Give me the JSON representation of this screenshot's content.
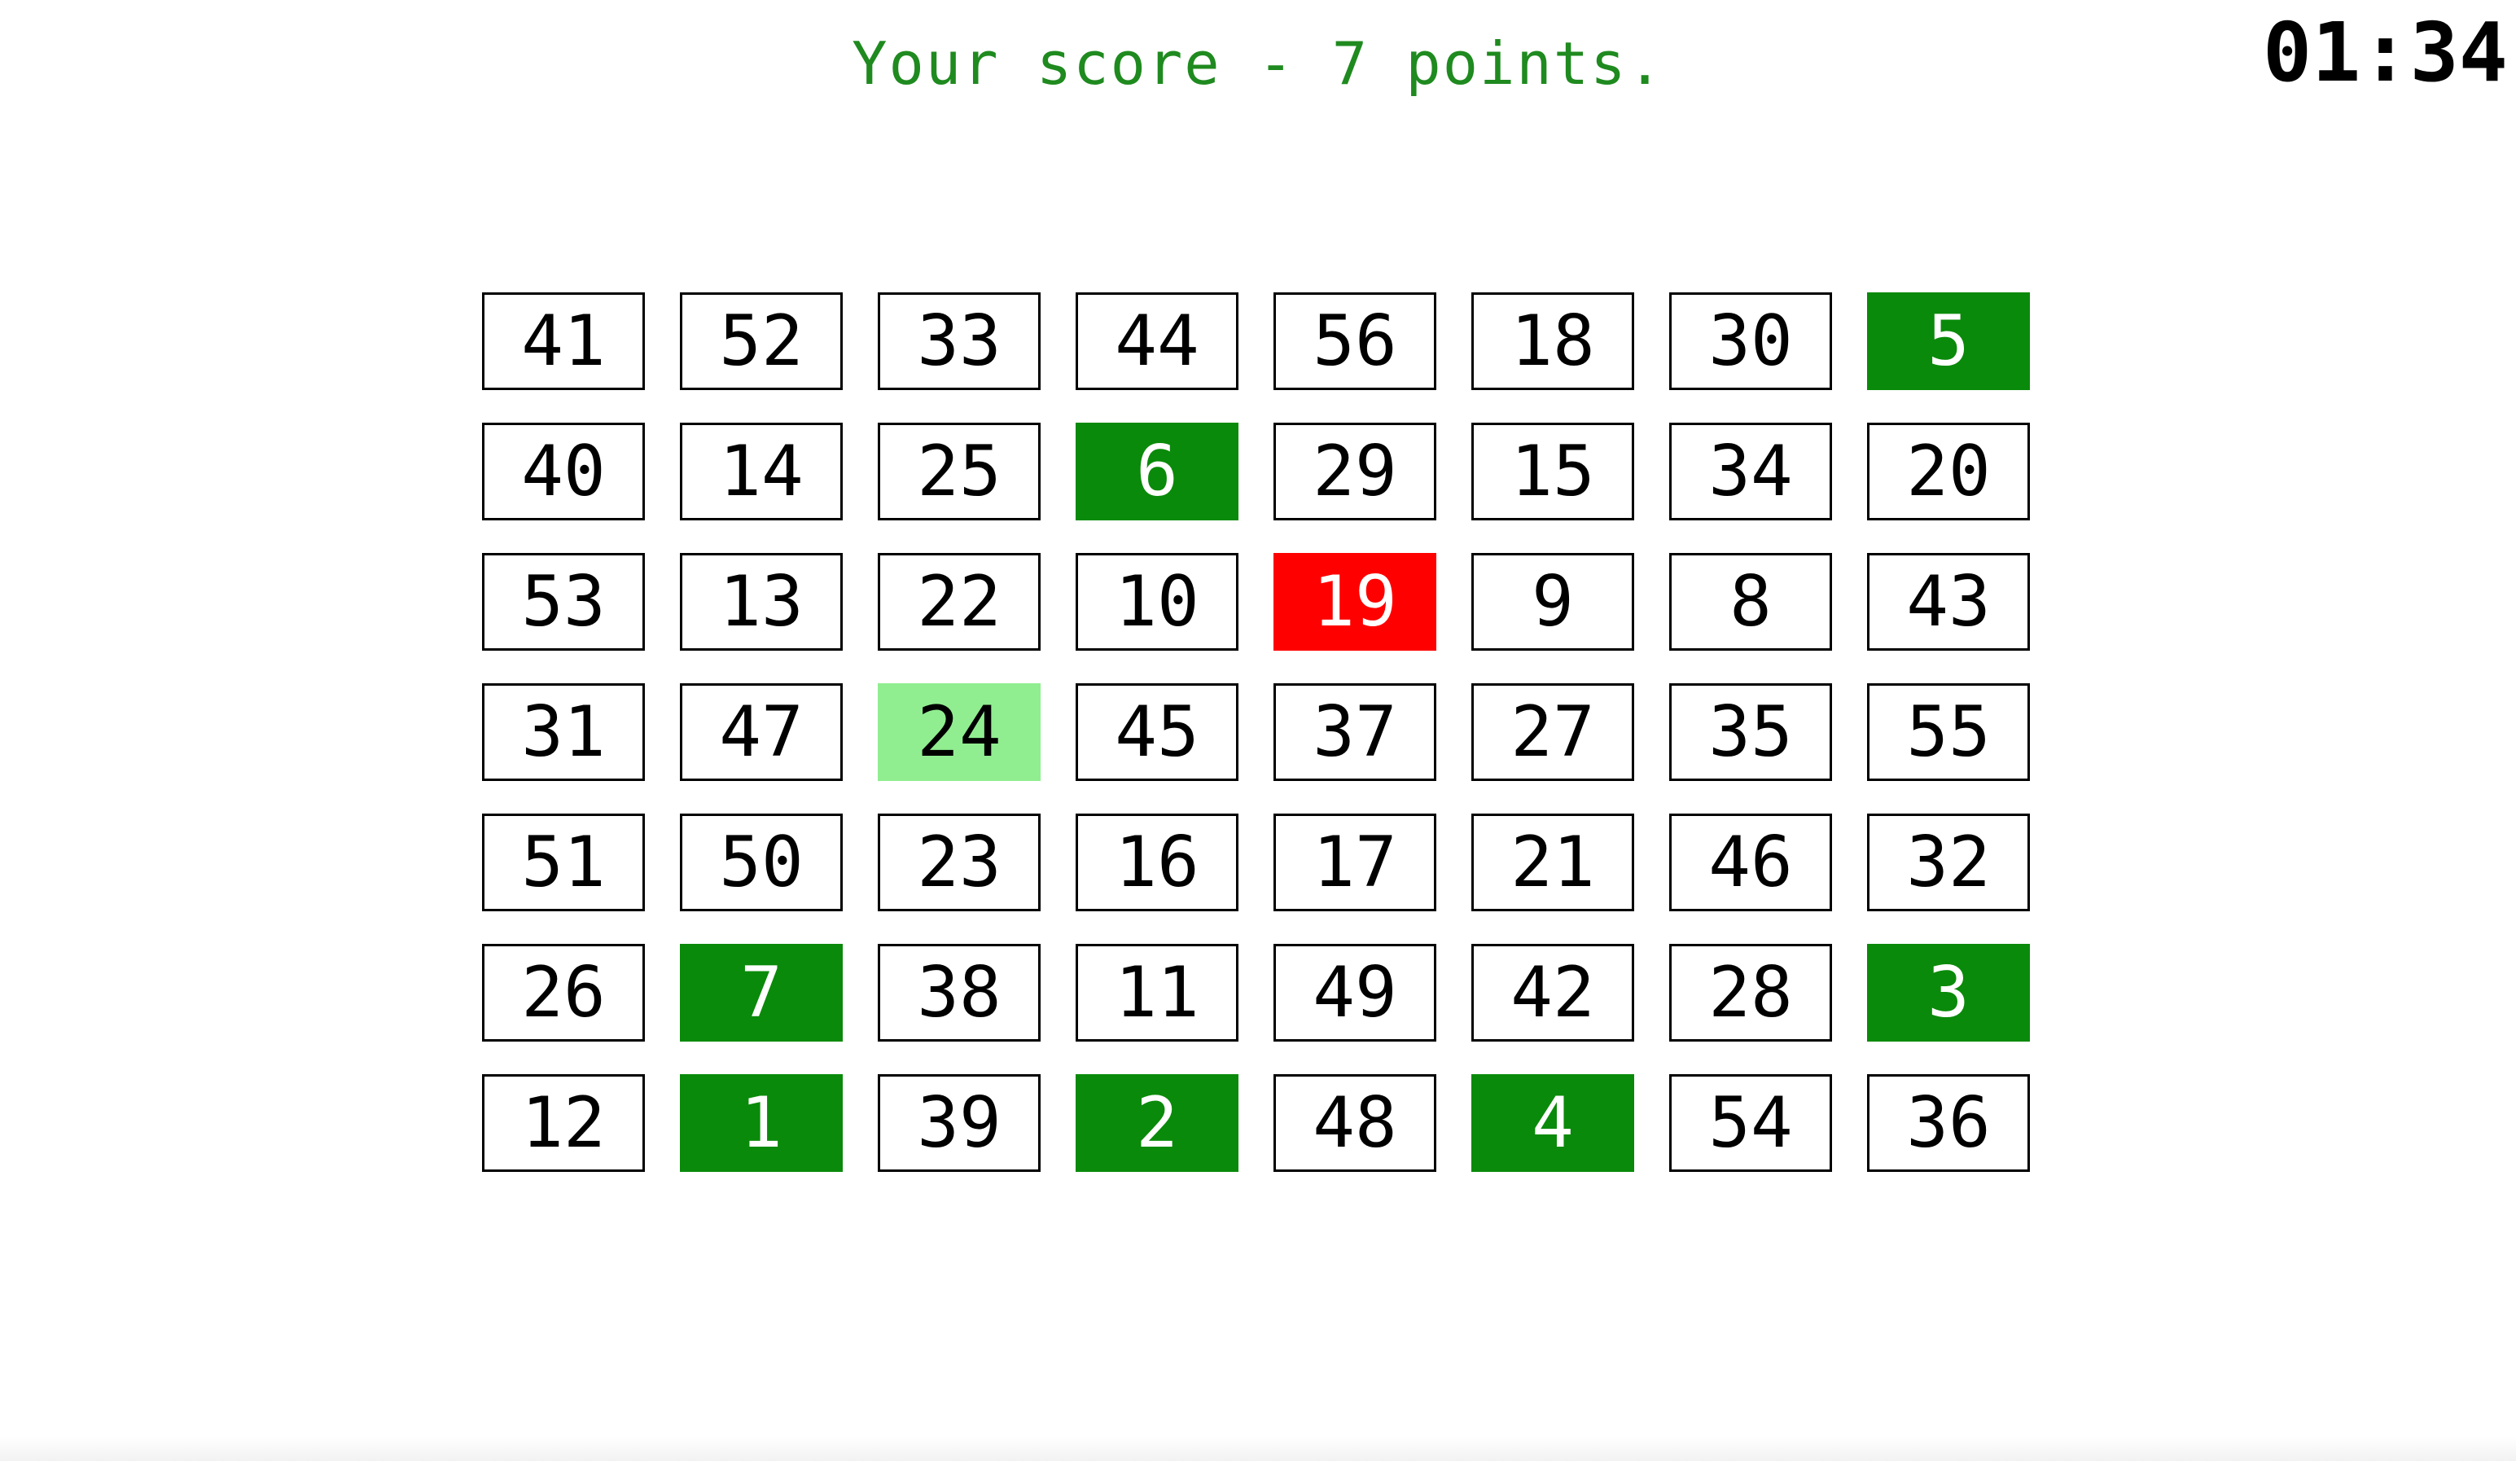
{
  "header": {
    "score_text": "Your score  -  7 points.",
    "timer": "01:34"
  },
  "colors": {
    "found": "#0a8a0a",
    "next": "#90ee90",
    "wrong": "#ff0000",
    "score_text": "#1f8a1f"
  },
  "grid": {
    "rows": 7,
    "columns": 8,
    "cells": [
      {
        "value": "41",
        "state": "default"
      },
      {
        "value": "52",
        "state": "default"
      },
      {
        "value": "33",
        "state": "default"
      },
      {
        "value": "44",
        "state": "default"
      },
      {
        "value": "56",
        "state": "default"
      },
      {
        "value": "18",
        "state": "default"
      },
      {
        "value": "30",
        "state": "default"
      },
      {
        "value": "5",
        "state": "found"
      },
      {
        "value": "40",
        "state": "default"
      },
      {
        "value": "14",
        "state": "default"
      },
      {
        "value": "25",
        "state": "default"
      },
      {
        "value": "6",
        "state": "found"
      },
      {
        "value": "29",
        "state": "default"
      },
      {
        "value": "15",
        "state": "default"
      },
      {
        "value": "34",
        "state": "default"
      },
      {
        "value": "20",
        "state": "default"
      },
      {
        "value": "53",
        "state": "default"
      },
      {
        "value": "13",
        "state": "default"
      },
      {
        "value": "22",
        "state": "default"
      },
      {
        "value": "10",
        "state": "default"
      },
      {
        "value": "19",
        "state": "wrong"
      },
      {
        "value": "9",
        "state": "default"
      },
      {
        "value": "8",
        "state": "default"
      },
      {
        "value": "43",
        "state": "default"
      },
      {
        "value": "31",
        "state": "default"
      },
      {
        "value": "47",
        "state": "default"
      },
      {
        "value": "24",
        "state": "next"
      },
      {
        "value": "45",
        "state": "default"
      },
      {
        "value": "37",
        "state": "default"
      },
      {
        "value": "27",
        "state": "default"
      },
      {
        "value": "35",
        "state": "default"
      },
      {
        "value": "55",
        "state": "default"
      },
      {
        "value": "51",
        "state": "default"
      },
      {
        "value": "50",
        "state": "default"
      },
      {
        "value": "23",
        "state": "default"
      },
      {
        "value": "16",
        "state": "default"
      },
      {
        "value": "17",
        "state": "default"
      },
      {
        "value": "21",
        "state": "default"
      },
      {
        "value": "46",
        "state": "default"
      },
      {
        "value": "32",
        "state": "default"
      },
      {
        "value": "26",
        "state": "default"
      },
      {
        "value": "7",
        "state": "found"
      },
      {
        "value": "38",
        "state": "default"
      },
      {
        "value": "11",
        "state": "default"
      },
      {
        "value": "49",
        "state": "default"
      },
      {
        "value": "42",
        "state": "default"
      },
      {
        "value": "28",
        "state": "default"
      },
      {
        "value": "3",
        "state": "found"
      },
      {
        "value": "12",
        "state": "default"
      },
      {
        "value": "1",
        "state": "found"
      },
      {
        "value": "39",
        "state": "default"
      },
      {
        "value": "2",
        "state": "found"
      },
      {
        "value": "48",
        "state": "default"
      },
      {
        "value": "4",
        "state": "found"
      },
      {
        "value": "54",
        "state": "default"
      },
      {
        "value": "36",
        "state": "default"
      }
    ]
  }
}
